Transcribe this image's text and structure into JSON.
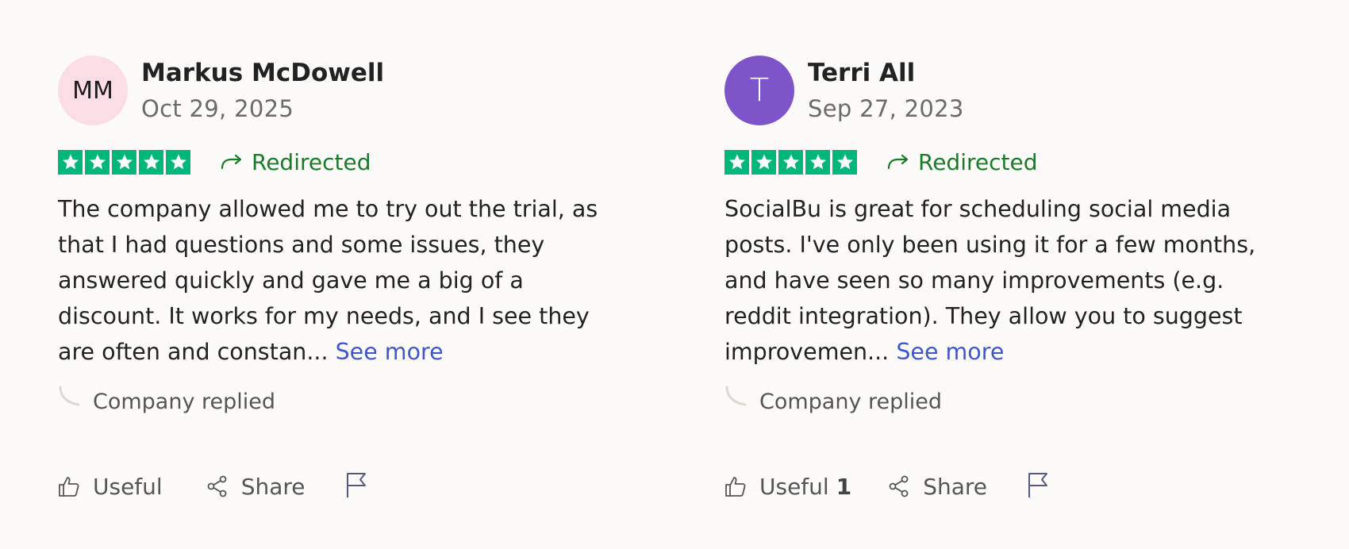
{
  "reviews": [
    {
      "avatar_initials": "MM",
      "avatar_bg": "#fbdde5",
      "avatar_fg": "#1c1c1c",
      "name": "Markus McDowell",
      "date": "Oct 29, 2025",
      "stars": 5,
      "redirect_label": "Redirected",
      "text": "The company allowed me to try out the trial, as that I had questions and some issues, they answered quickly and gave me a big of a discount. It works for my needs, and I see they are often and constan...",
      "see_more": "See more",
      "replied_label": "Company replied",
      "useful_label": "Useful",
      "useful_count": "",
      "share_label": "Share"
    },
    {
      "avatar_initials": "T",
      "avatar_bg": "#7e55c9",
      "avatar_fg": "#ffffff",
      "name": "Terri All",
      "date": "Sep 27, 2023",
      "stars": 5,
      "redirect_label": "Redirected",
      "text": "SocialBu is great for scheduling social media posts. I've only been using it for a few months, and have seen so many improvements (e.g. reddit integration). They allow you to suggest improvemen...",
      "see_more": "See more",
      "replied_label": "Company replied",
      "useful_label": "Useful",
      "useful_count": "1",
      "share_label": "Share"
    }
  ],
  "colors": {
    "star_green": "#00b67a",
    "redirect_green": "#1d7a2a",
    "link_blue": "#3f57c9"
  },
  "icons": {
    "redirect": "redirect-arrow-icon",
    "useful": "thumbs-up-icon",
    "share": "share-icon",
    "report": "flag-icon",
    "reply": "reply-curve-icon",
    "star": "star-icon"
  }
}
